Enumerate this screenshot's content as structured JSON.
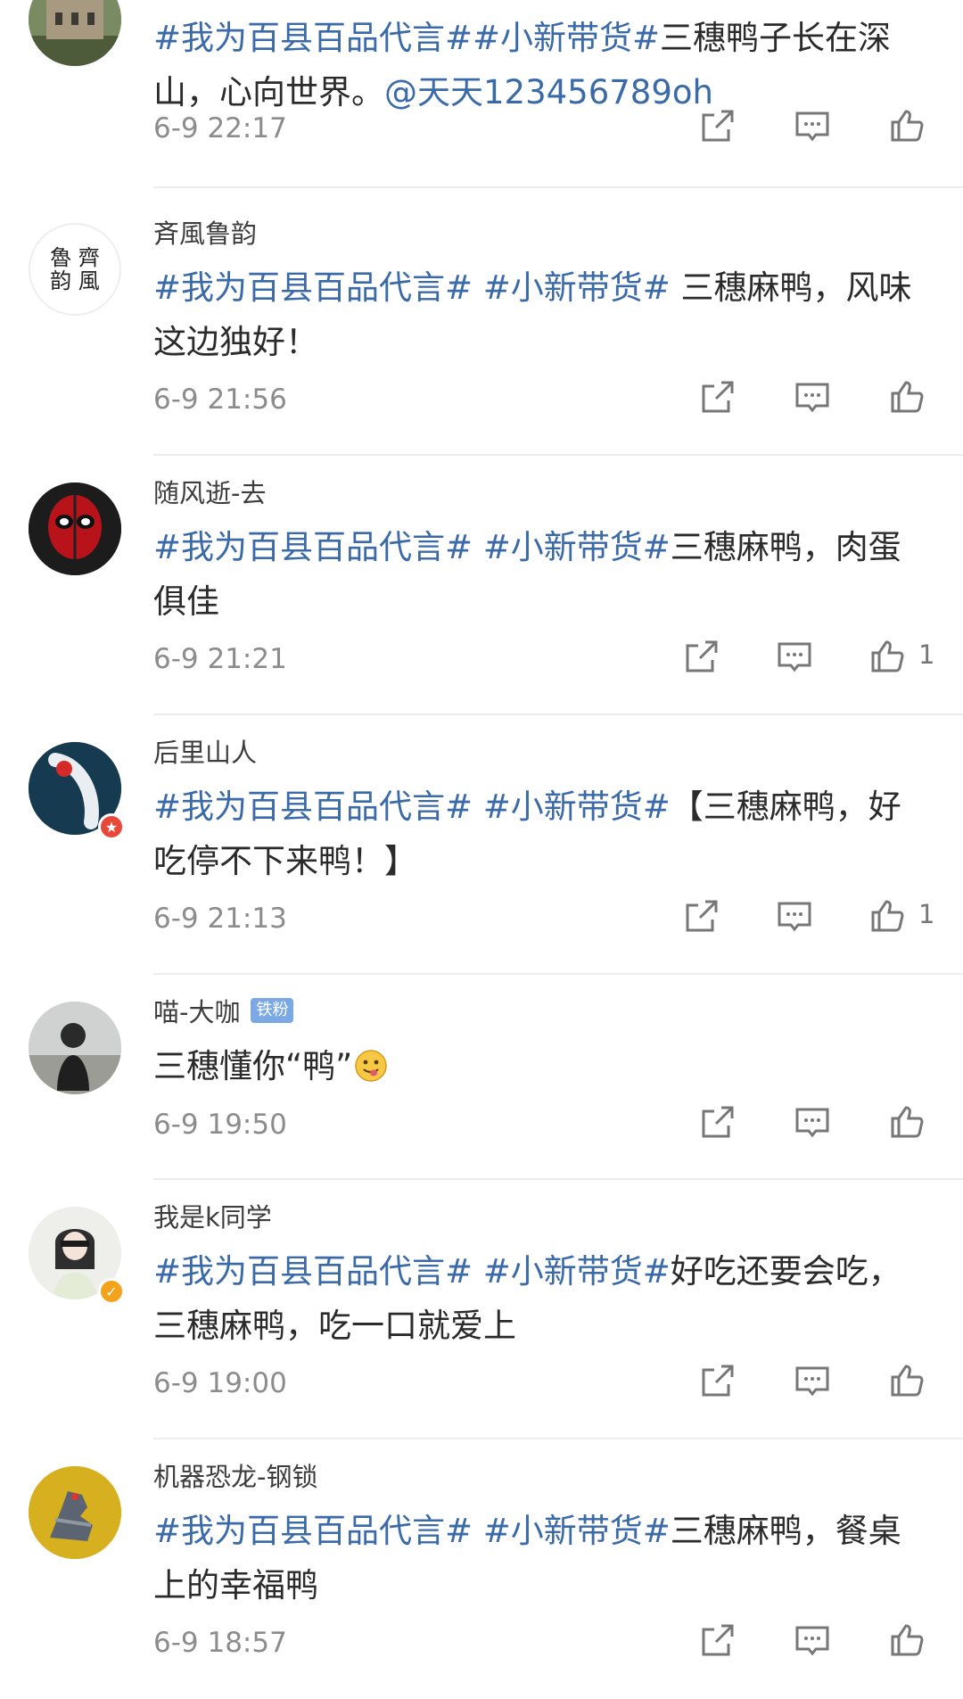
{
  "comments": [
    {
      "username": "",
      "badge": "",
      "content_parts": [
        {
          "type": "tag",
          "text": "#我为百县百品代言#"
        },
        {
          "type": "tag",
          "text": "#小新带货#"
        },
        {
          "type": "text",
          "text": "三穗鸭子长在深山，心向世界。"
        },
        {
          "type": "mention",
          "text": "@天天123456789oh"
        }
      ],
      "time": "6-9 22:17",
      "likes": "",
      "avatar_icon": "castle-avatar"
    },
    {
      "username": "斉風鲁韵",
      "badge": "",
      "content_parts": [
        {
          "type": "tag",
          "text": "#我为百县百品代言# #小新带货#"
        },
        {
          "type": "text",
          "text": " 三穗麻鸭，风味这边独好！"
        }
      ],
      "time": "6-9 21:56",
      "likes": "",
      "avatar_text": "魯 齊\n韵 風"
    },
    {
      "username": "随风逝-去",
      "badge": "",
      "content_parts": [
        {
          "type": "tag",
          "text": "#我为百县百品代言# #小新带货#"
        },
        {
          "type": "text",
          "text": "三穗麻鸭，肉蛋俱佳"
        }
      ],
      "time": "6-9 21:21",
      "likes": "1",
      "avatar_icon": "masked-hero-avatar"
    },
    {
      "username": "后里山人",
      "badge": "red",
      "content_parts": [
        {
          "type": "tag",
          "text": "#我为百县百品代言# #小新带货#"
        },
        {
          "type": "text",
          "text": "【三穗麻鸭，好吃停不下来鸭！】"
        }
      ],
      "time": "6-9 21:13",
      "likes": "1",
      "avatar_icon": "koi-avatar"
    },
    {
      "username": "喵-大咖",
      "fan_tag": "铁粉",
      "badge": "",
      "content_parts": [
        {
          "type": "text",
          "text": "三穗懂你“鸭”"
        },
        {
          "type": "emoji",
          "text": ""
        }
      ],
      "time": "6-9 19:50",
      "likes": "",
      "avatar_icon": "person-avatar"
    },
    {
      "username": "我是k同学",
      "badge": "orange",
      "content_parts": [
        {
          "type": "tag",
          "text": "#我为百县百品代言# #小新带货#"
        },
        {
          "type": "text",
          "text": "好吃还要会吃，三穗麻鸭，吃一口就爱上"
        }
      ],
      "time": "6-9 19:00",
      "likes": "",
      "avatar_icon": "girl-avatar"
    },
    {
      "username": "机器恐龙-钢锁",
      "badge": "",
      "content_parts": [
        {
          "type": "tag",
          "text": "#我为百县百品代言# #小新带货#"
        },
        {
          "type": "text",
          "text": "三穗麻鸭，餐桌上的幸福鸭"
        }
      ],
      "time": "6-9 18:57",
      "likes": "",
      "avatar_icon": "robot-dinosaur-avatar"
    }
  ],
  "colors": {
    "tag": "#3b6aa8",
    "time": "#8c8c8c",
    "icon": "#777777"
  }
}
